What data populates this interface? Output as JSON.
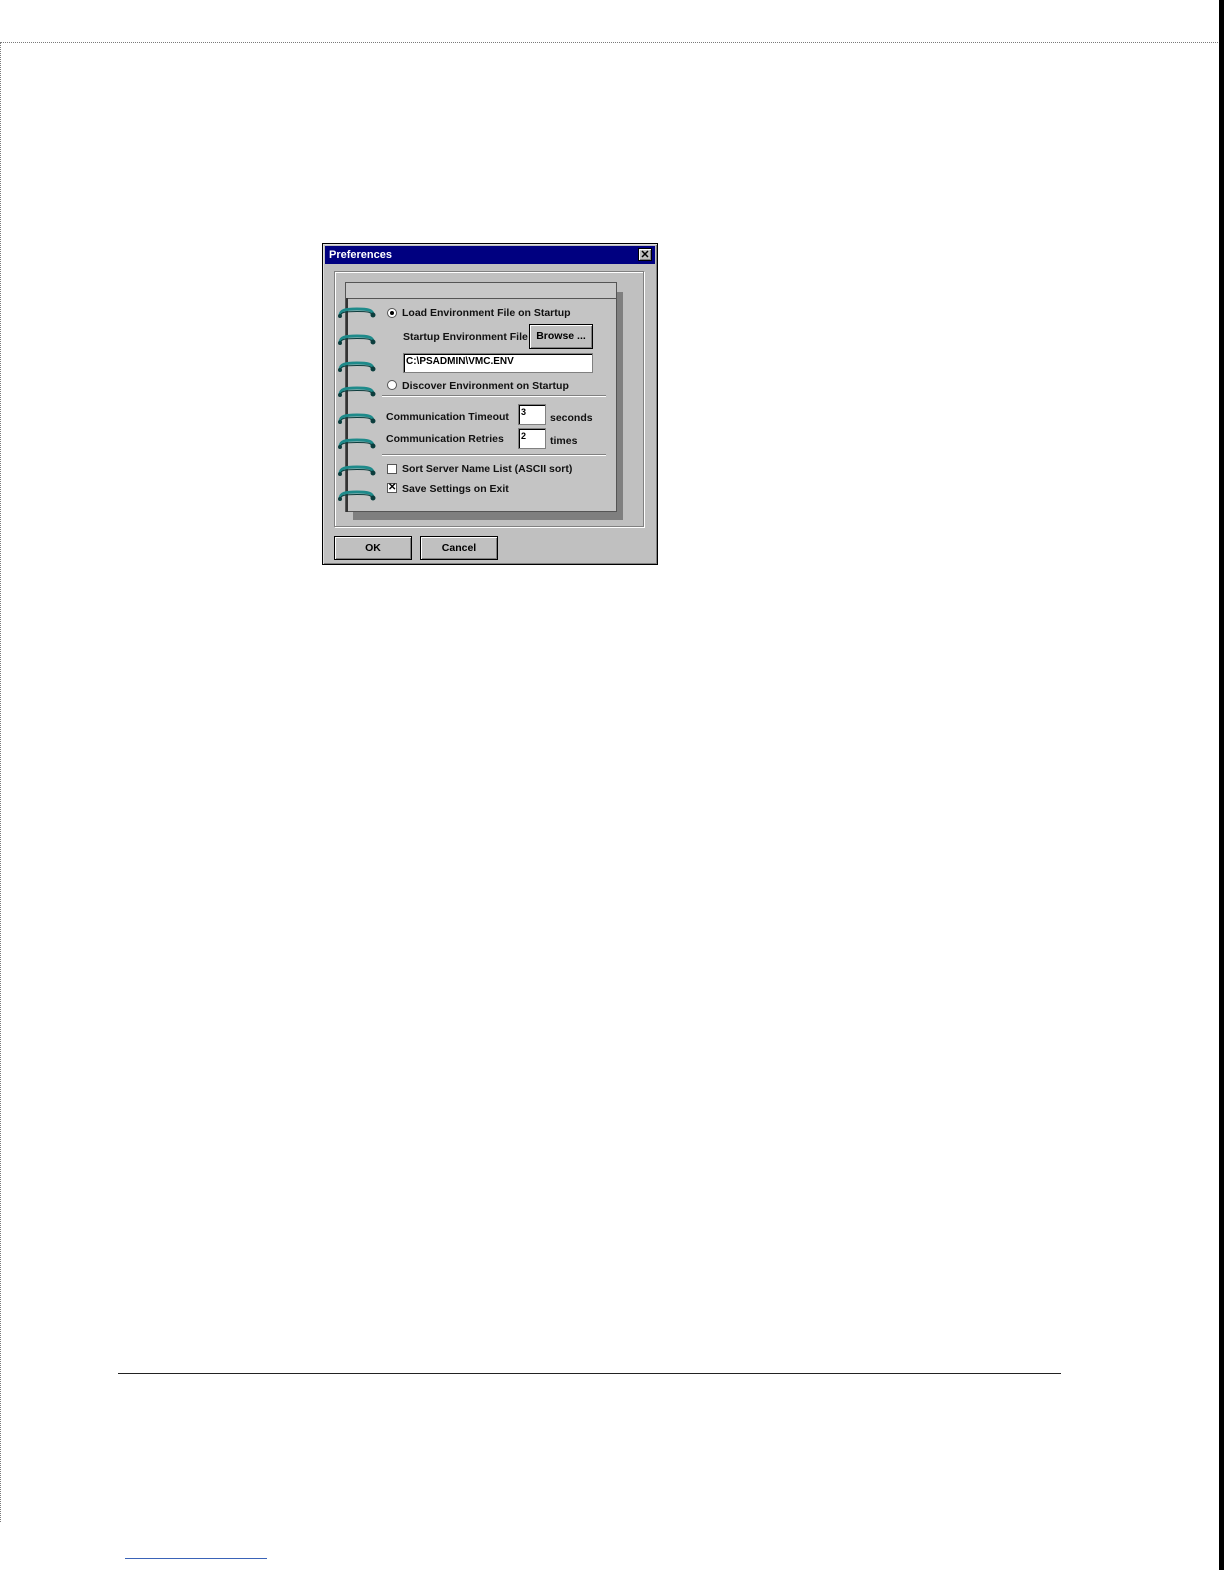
{
  "dialog": {
    "title": "Preferences",
    "close_glyph": "✕",
    "load_env_label": "Load Environment File on Startup",
    "load_env_selected": true,
    "startup_file_label": "Startup Environment File",
    "browse_label": "Browse ...",
    "env_file_path": "C:\\PSADMIN\\VMC.ENV",
    "discover_env_label": "Discover Environment on Startup",
    "discover_env_selected": false,
    "timeout_label": "Communication Timeout",
    "timeout_value": "3",
    "timeout_unit": "seconds",
    "retries_label": "Communication Retries",
    "retries_value": "2",
    "retries_unit": "times",
    "sort_label": "Sort Server Name List (ASCII sort)",
    "sort_checked": false,
    "save_label": "Save Settings on Exit",
    "save_checked": true,
    "check_glyph": "✕",
    "ok_label": "OK",
    "cancel_label": "Cancel"
  },
  "colors": {
    "titlebar": "#000080",
    "dialog_face": "#c0c0c0",
    "ring": "#1e8a8a"
  },
  "icons": [
    "close-icon",
    "notebook-ring-icon"
  ]
}
